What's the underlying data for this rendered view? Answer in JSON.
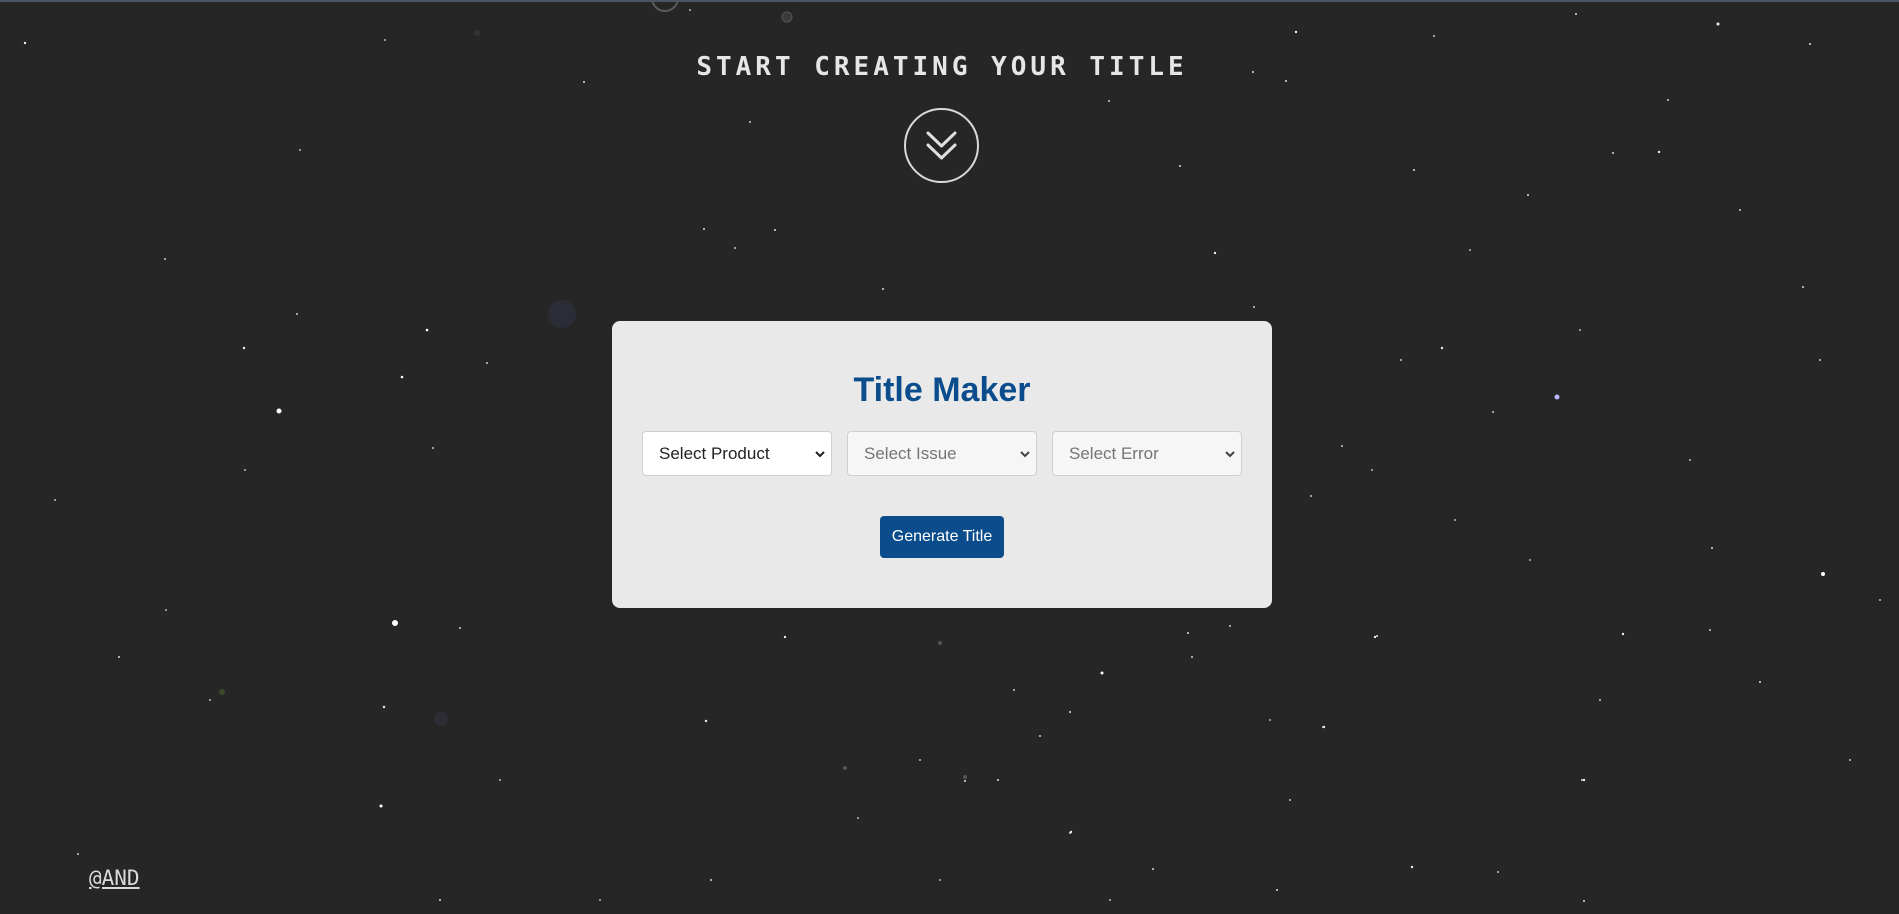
{
  "hero": {
    "title": "START CREATING YOUR TITLE"
  },
  "icons": {
    "scroll": "chevrons-down-icon",
    "dropdown": "chevron-down-icon"
  },
  "card": {
    "title": "Title Maker",
    "selects": {
      "product": {
        "value": "Select Product"
      },
      "issue": {
        "value": "Select Issue"
      },
      "error": {
        "value": "Select Error"
      }
    },
    "generate_label": "Generate Title"
  },
  "footer": {
    "link": "@AND"
  },
  "colors": {
    "background": "#262626",
    "card": "#e9e9e9",
    "accent": "#0b4d8c",
    "heading": "#e6e6e6"
  }
}
